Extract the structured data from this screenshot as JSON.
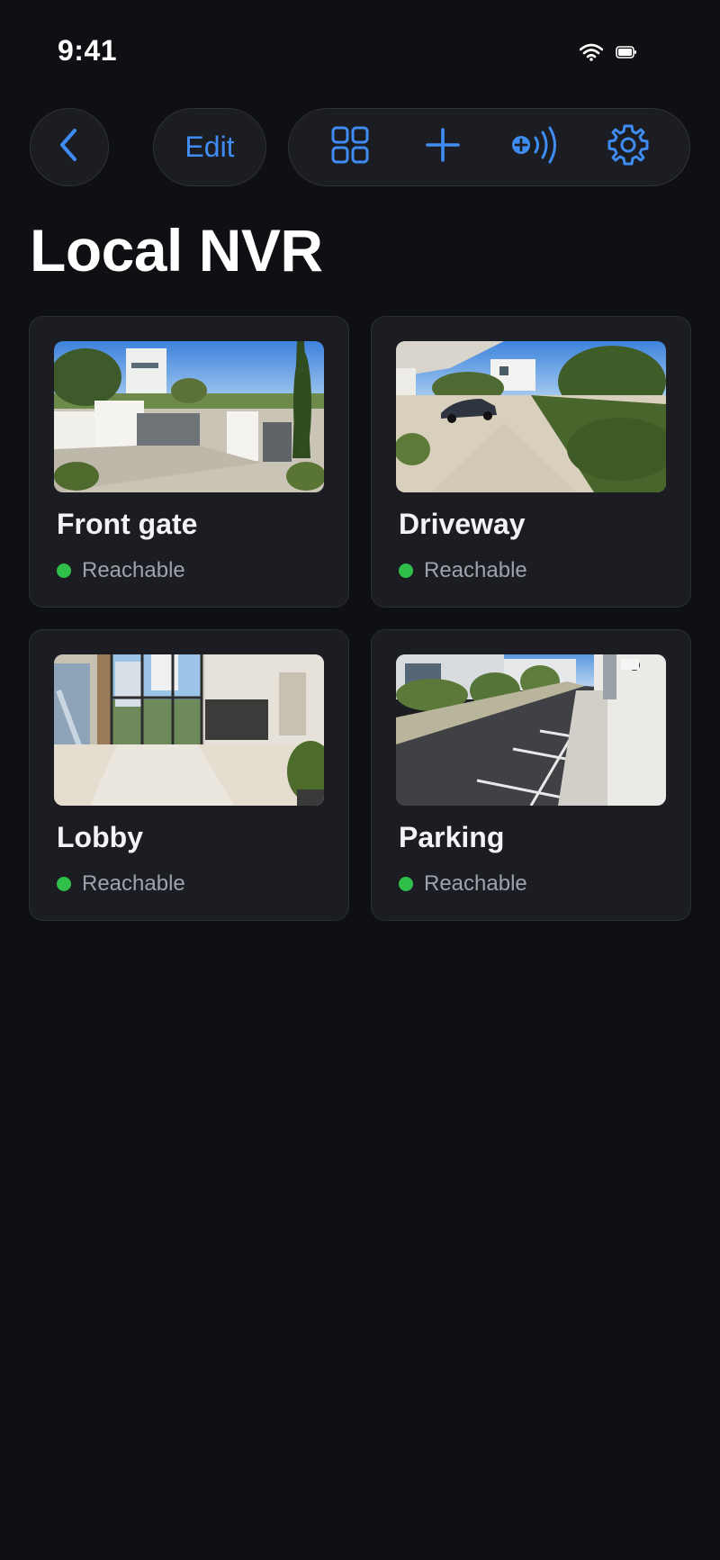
{
  "status_bar": {
    "time": "9:41"
  },
  "toolbar": {
    "back_icon": "chevron-left-icon",
    "edit_label": "Edit",
    "actions": [
      "grid-view-icon",
      "plus-icon",
      "add-broadcast-icon",
      "gear-icon"
    ]
  },
  "page": {
    "title": "Local NVR"
  },
  "colors": {
    "accent": "#3f8cf2",
    "reachable": "#2fbf4a",
    "background": "#0f1013",
    "card": "#1b1d23"
  },
  "cameras": [
    {
      "name": "Front gate",
      "status": "Reachable",
      "thumbnail": "front-gate-image"
    },
    {
      "name": "Driveway",
      "status": "Reachable",
      "thumbnail": "driveway-image"
    },
    {
      "name": "Lobby",
      "status": "Reachable",
      "thumbnail": "lobby-image"
    },
    {
      "name": "Parking",
      "status": "Reachable",
      "thumbnail": "parking-image"
    }
  ]
}
